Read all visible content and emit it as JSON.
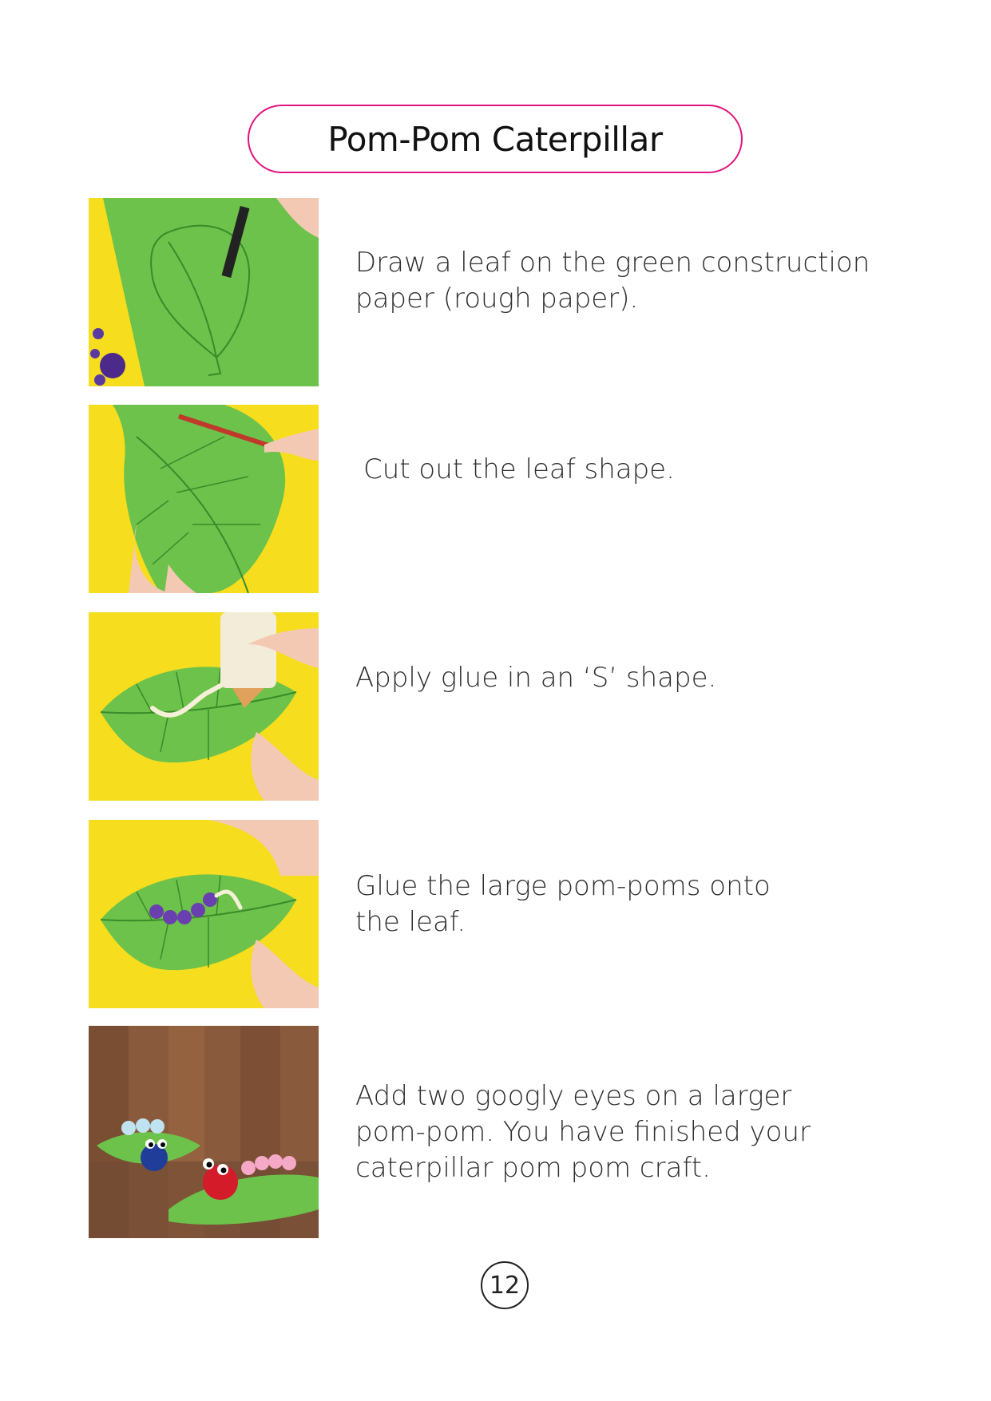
{
  "title": "Pom-Pom Caterpillar",
  "steps": [
    {
      "text": "Draw a leaf on the green construction\npaper (rough paper).",
      "image": "drawing-leaf-photo"
    },
    {
      "text": "Cut out the leaf shape.",
      "image": "cutting-leaf-photo"
    },
    {
      "text": "Apply glue in an ‘S’ shape.",
      "image": "glue-s-shape-photo"
    },
    {
      "text": "Glue the large pom-poms onto\nthe leaf.",
      "image": "pom-poms-on-leaf-photo"
    },
    {
      "text": "Add two googly eyes on a larger\npom-pom. You have finished your\ncaterpillar pom pom craft.",
      "image": "finished-caterpillars-photo"
    }
  ],
  "page_number": "12",
  "colors": {
    "accent": "#e0147e",
    "leaf": "#6cc24a",
    "background_yellow": "#ffe21a"
  }
}
